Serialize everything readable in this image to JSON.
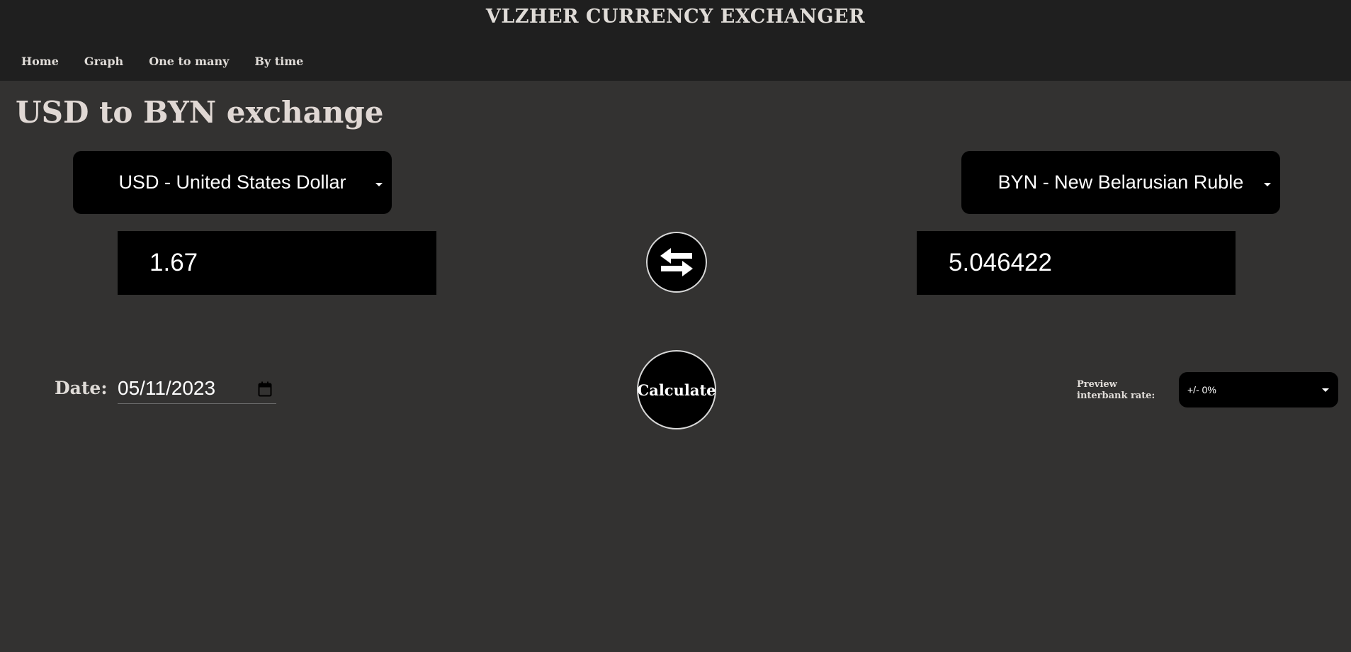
{
  "app": {
    "title": "VLZHER CURRENCY EXCHANGER"
  },
  "nav": {
    "items": [
      {
        "label": "Home"
      },
      {
        "label": "Graph"
      },
      {
        "label": "One to many"
      },
      {
        "label": "By time"
      }
    ]
  },
  "main": {
    "title": "USD to BYN exchange",
    "from_currency": {
      "selected": "USD - United States Dollar"
    },
    "to_currency": {
      "selected": "BYN - New Belarusian Ruble"
    },
    "from_amount": "1.67",
    "to_amount": "5.046422",
    "date": {
      "label": "Date:",
      "value": "05/11/2023"
    },
    "calculate_label": "Calculate",
    "preview": {
      "label": "Preview interbank rate:",
      "selected": "+/- 0%"
    }
  },
  "icons": {
    "swap": "swap-arrows-icon",
    "calendar": "calendar-icon",
    "dropdown": "chevron-down-icon"
  }
}
